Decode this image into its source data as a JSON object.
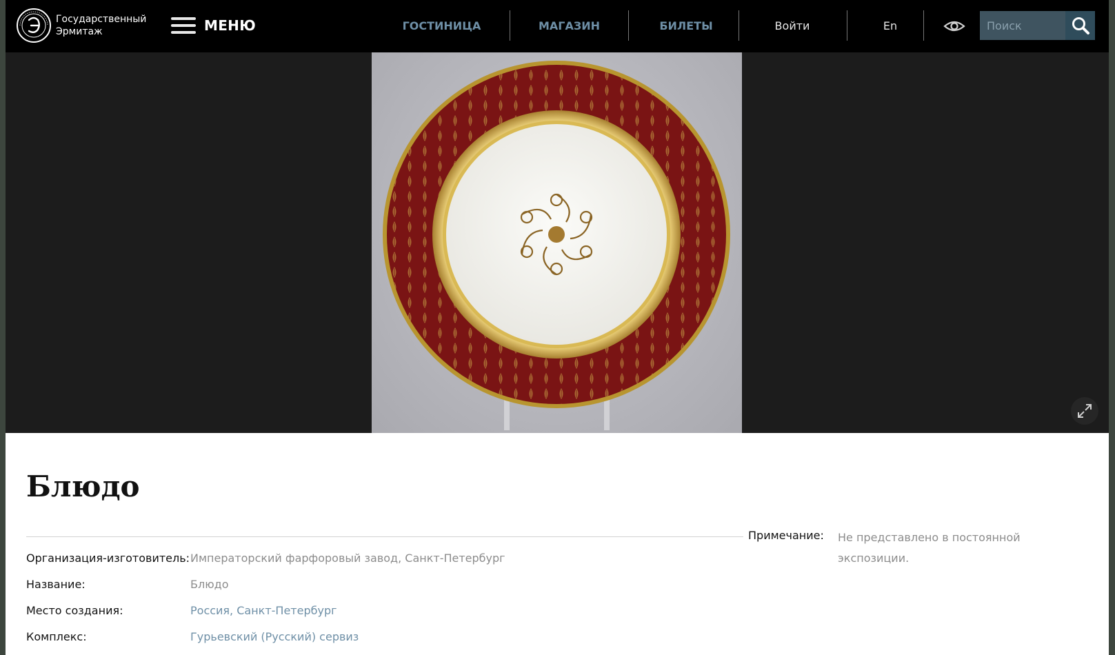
{
  "header": {
    "logo_text_line1": "Государственный",
    "logo_text_line2": "Эрмитаж",
    "menu_label": "МЕНЮ",
    "nav": {
      "hotel": "ГОСТИНИЦА",
      "shop": "МАГАЗИН",
      "tickets": "БИЛЕТЫ",
      "login": "Войти",
      "lang": "En"
    },
    "search_placeholder": "Поиск",
    "icons": [
      "menu-icon",
      "eye-icon",
      "search-icon"
    ]
  },
  "artwork": {
    "image_icon": "porcelain-dish-image",
    "expand_icon": "expand-icon"
  },
  "details": {
    "title": "Блюдо",
    "fields": [
      {
        "label": "Организация-изготовитель:",
        "value": "Императорский фарфоровый завод, Санкт-Петербург"
      },
      {
        "label": "Название:",
        "value": "Блюдо"
      },
      {
        "label": "Место создания:",
        "value": "Россия, Санкт-Петербург"
      },
      {
        "label": "Комплекс:",
        "value": "Гурьевский (Русский) сервиз"
      }
    ],
    "note_label": "Примечание:",
    "note_value": "Не представлено в постоянной экспозиции."
  },
  "colors": {
    "header_bg": "#000000",
    "nav_link": "#6e8fa6",
    "stage_bg": "#1c1c1c",
    "plate_rim": "#7a1414",
    "gold": "#c9a548"
  }
}
